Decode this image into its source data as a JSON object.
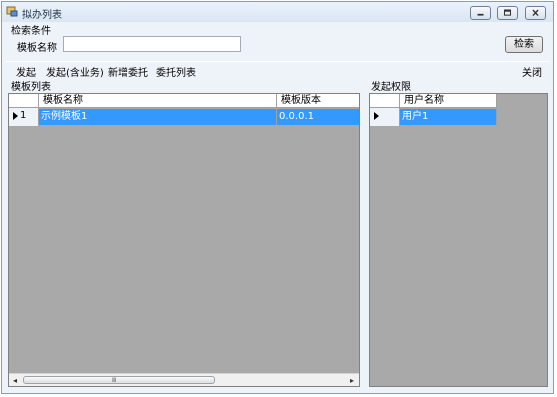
{
  "window": {
    "title": "拟办列表",
    "controls": [
      "minimize-icon",
      "maximize-icon",
      "close-icon"
    ]
  },
  "search": {
    "group_label": "检索条件",
    "field_label": "模板名称",
    "value": "",
    "placeholder": "",
    "button_label": "检索"
  },
  "toolbar": {
    "items": [
      "发起",
      "发起(含业务)",
      "新增委托",
      "委托列表"
    ],
    "close_label": "关闭"
  },
  "templates": {
    "section_label": "模板列表",
    "columns": [
      "模板名称",
      "模板版本"
    ],
    "rows": [
      {
        "row_no": "1",
        "name": "示例模板1",
        "version": "0.0.0.1"
      }
    ],
    "scroll_grip": "Ⅲ"
  },
  "permissions": {
    "section_label": "发起权限",
    "columns": [
      "用户名称"
    ],
    "rows": [
      {
        "user": "用户1"
      }
    ]
  },
  "colors": {
    "selection": "#3399ff",
    "grid_background": "#a9a9a9",
    "window_background": "#eef3f9"
  }
}
